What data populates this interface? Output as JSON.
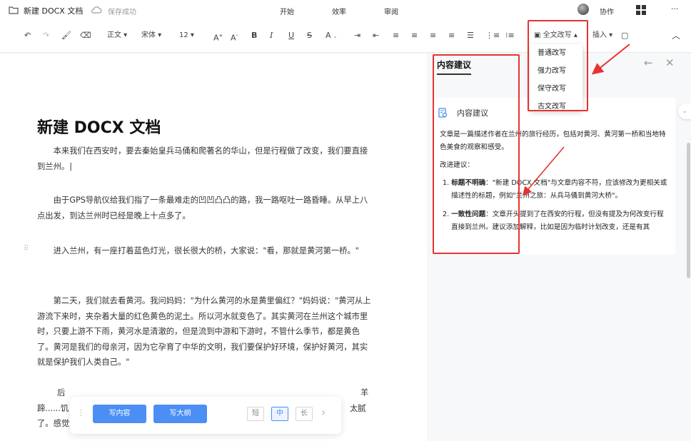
{
  "topbar": {
    "title": "新建 DOCX 文档",
    "save_status": "保存成功",
    "tabs": [
      "开始",
      "效率",
      "审阅"
    ],
    "collaborate": "协作",
    "more": "···"
  },
  "toolbar": {
    "style": "正文",
    "font": "宋体",
    "size": "12",
    "rewrite": "全文改写",
    "insert": "插入"
  },
  "rewrite_menu": [
    "普通改写",
    "强力改写",
    "保守改写",
    "古文改写"
  ],
  "document": {
    "title": "新建 DOCX 文档",
    "paragraphs": [
      "本来我们在西安时，要去秦始皇兵马俑和爬著名的华山，但是行程做了改变，我们要直接到兰州。|",
      "由于GPS导航仪给我们指了一条最难走的凹凹凸凸的路，我一路呕吐一路昏睡。从早上八点出发，到达兰州时已经是晚上十点多了。",
      "进入兰州，有一座打着蓝色灯光，很长很大的桥，大家说：\"看，那就是黄河第一桥。\"",
      "第二天，我们就去看黄河。我问妈妈：\"为什么黄河的水是黄里偏红？\"妈妈说：\"黄河从上游流下来时，夹杂着大量的红色黄色的泥土。所以河水就变色了。其实黄河在兰州这个城市里时，只要上游不下雨，黄河水是清澈的，但是流到中游和下游时，不管什么季节，都是黄色了。黄河是我们的母亲河，因为它孕育了中华的文明，我们要保护好环境，保护好黄河，其实就是保护我们人类自己。\""
    ],
    "partial_lines": [
      "后",
      "蹄......饥",
      "了。感觉"
    ],
    "partial_right": [
      "羊",
      "太腻"
    ]
  },
  "bottom_bar": {
    "write_content": "写内容",
    "write_outline": "写大纲",
    "lengths": [
      "短",
      "中",
      "长"
    ]
  },
  "panel": {
    "heading": "内容建议",
    "card_title": "内容建议",
    "intro": "文章是一篇描述作者在兰州的旅行经历，包括对黄河、黄河第一桥和当地特色美食的观察和感受。",
    "improve_label": "改进建议：",
    "items": [
      {
        "bold": "标题不明确",
        "text": "：\"新建 DOCX 文档\"与文章内容不符，应该修改为更相关或描述性的标题，例如\"兰州之旅：从兵马俑到黄河大桥\"。"
      },
      {
        "bold": "一致性问题",
        "text": "：文章开头提到了在西安的行程，但没有提及为何改变行程直接到兰州。建议添加解释，比如是因为临时计划改变，还是有其"
      }
    ]
  },
  "colors": {
    "accent": "#4b8ff5",
    "annotation": "#e63232"
  }
}
